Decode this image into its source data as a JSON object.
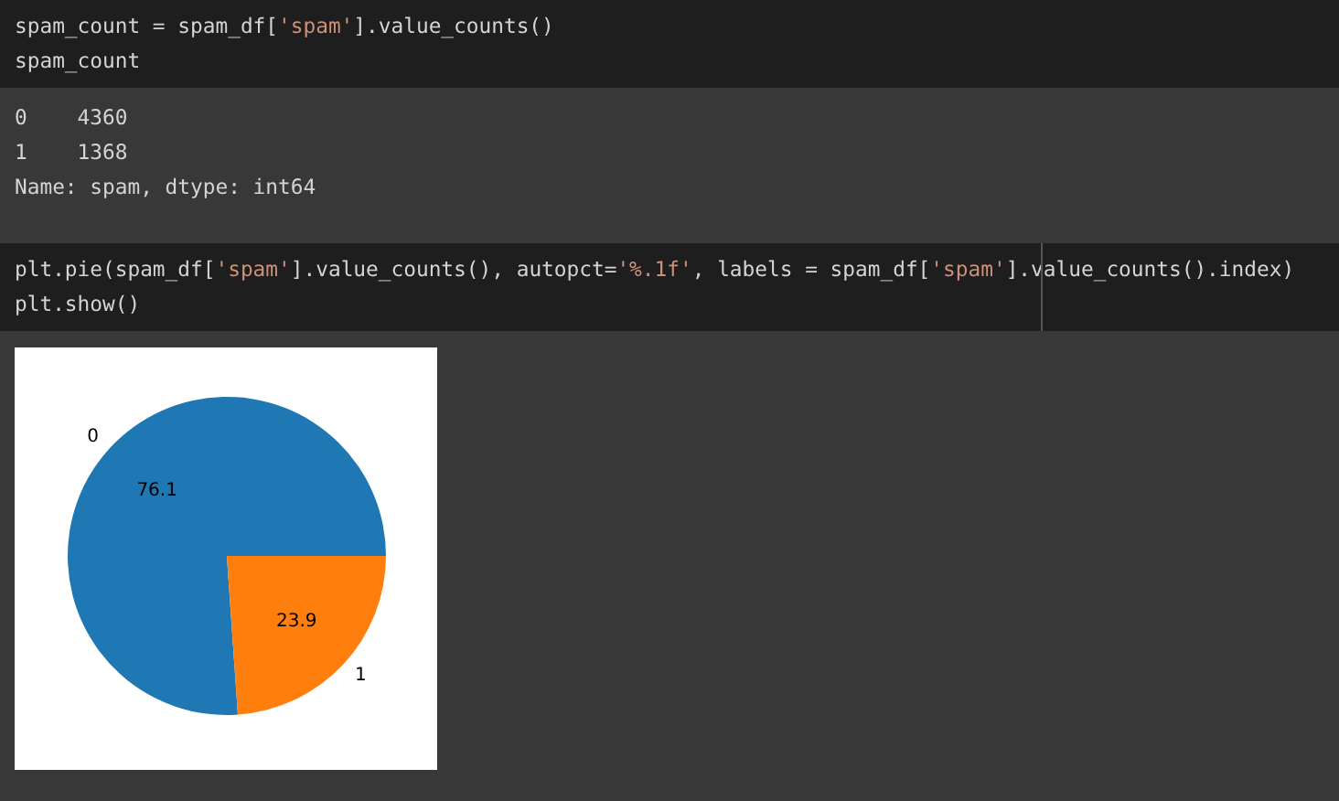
{
  "cells": [
    {
      "input": [
        [
          {
            "kind": "code",
            "text": "spam_count = spam_df["
          },
          {
            "kind": "string",
            "text": "'spam'"
          },
          {
            "kind": "code",
            "text": "].value_counts()"
          }
        ],
        [
          {
            "kind": "code",
            "text": "spam_count"
          }
        ]
      ],
      "output": {
        "kind": "text",
        "lines": [
          "0    4360",
          "1    1368",
          "Name: spam, dtype: int64"
        ]
      }
    },
    {
      "input": [
        [
          {
            "kind": "code",
            "text": "plt.pie(spam_df["
          },
          {
            "kind": "string",
            "text": "'spam'"
          },
          {
            "kind": "code",
            "text": "].value_counts(), autopct="
          },
          {
            "kind": "string",
            "text": "'%.1f'"
          },
          {
            "kind": "code",
            "text": ", labels = spam_df["
          },
          {
            "kind": "string",
            "text": "'spam'"
          },
          {
            "kind": "code",
            "text": "].value_counts().index)"
          }
        ],
        [
          {
            "kind": "code",
            "text": "plt.show()"
          }
        ]
      ],
      "output": {
        "kind": "chart",
        "chart_data": {
          "type": "pie",
          "categories": [
            "0",
            "1"
          ],
          "values": [
            76.1,
            23.9
          ],
          "data_labels": true,
          "value_labels": [
            "76.1",
            "23.9"
          ],
          "colors": [
            "#1f77b4",
            "#ff7f0e"
          ]
        }
      }
    }
  ]
}
